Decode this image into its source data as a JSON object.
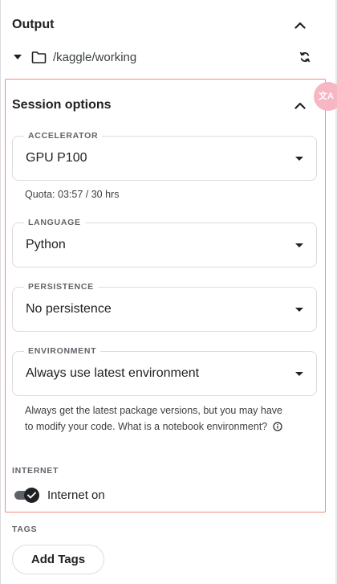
{
  "output": {
    "title": "Output",
    "path": "/kaggle/working"
  },
  "session": {
    "title": "Session options",
    "accelerator": {
      "label": "ACCELERATOR",
      "value": "GPU P100"
    },
    "quota": "Quota: 03:57 / 30 hrs",
    "language": {
      "label": "LANGUAGE",
      "value": "Python"
    },
    "persistence": {
      "label": "PERSISTENCE",
      "value": "No persistence"
    },
    "environment": {
      "label": "ENVIRONMENT",
      "value": "Always use latest environment",
      "help": "Always get the latest package versions, but you may have to modify your code. What is a notebook environment?"
    },
    "internet": {
      "label": "INTERNET",
      "toggle_label": "Internet on",
      "enabled": true
    }
  },
  "tags": {
    "label": "TAGS",
    "add_button": "Add Tags"
  },
  "colors": {
    "highlight_border": "#f28b82",
    "translate_fab": "#f7b6c4",
    "text_primary": "#202124",
    "text_secondary": "#5f6368"
  },
  "icons": [
    "caret-up-icon",
    "triangle-down-icon",
    "folder-icon",
    "refresh-icon",
    "dropdown-arrow-icon",
    "info-icon",
    "check-icon",
    "translate-icon"
  ]
}
